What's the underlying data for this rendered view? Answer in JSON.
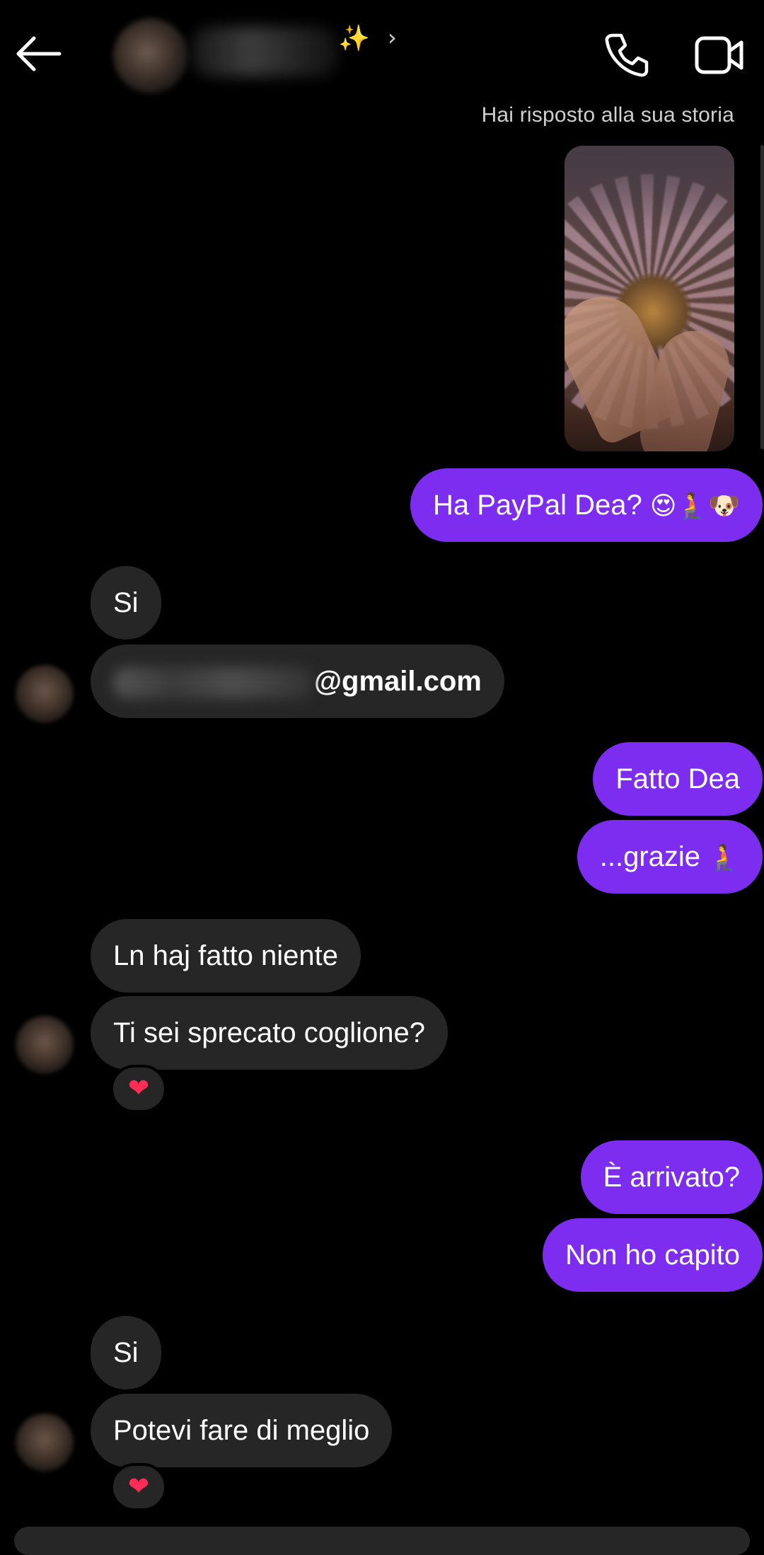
{
  "header": {
    "contact_name_suffix": "✨",
    "chevron": "›",
    "back_icon": "arrow-left-icon",
    "call_icon": "phone-icon",
    "video_icon": "video-icon"
  },
  "story_note": "Hai risposto alla sua storia",
  "messages": {
    "m1": {
      "text": "Ha PayPal Dea? ",
      "emoji": "😍🧎🐶"
    },
    "m2": {
      "text": "Si"
    },
    "m3": {
      "email_suffix": "@gmail.com"
    },
    "m4": {
      "text": "Fatto Dea"
    },
    "m5": {
      "text": "...grazie ",
      "emoji": "🧎"
    },
    "m6": {
      "text": "Ln haj fatto niente"
    },
    "m7": {
      "text": "Ti sei sprecato coglione?"
    },
    "m8": {
      "text": "È arrivato?"
    },
    "m9": {
      "text": "Non ho capito"
    },
    "m10": {
      "text": "Si"
    },
    "m11": {
      "text": "Potevi fare di meglio"
    }
  },
  "reaction": "❤",
  "colors": {
    "outgoing_bubble": "#7c2df0",
    "incoming_bubble": "#262626",
    "background": "#000000",
    "reaction": "#ff2d55"
  }
}
